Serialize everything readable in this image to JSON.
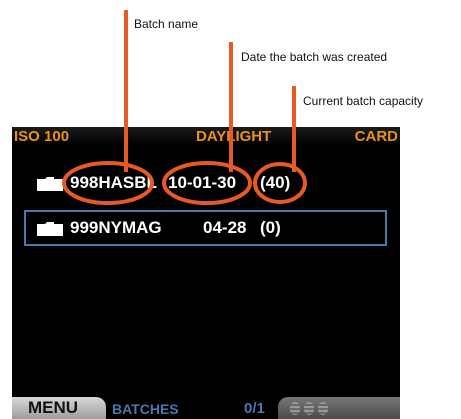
{
  "callouts": {
    "batch_name": "Batch name",
    "date_created": "Date the batch was created",
    "capacity": "Current batch capacity"
  },
  "status_bar": {
    "iso": "ISO 100",
    "white_balance": "DAYLIGHT",
    "storage": "CARD"
  },
  "batches": [
    {
      "name": "998HASBL",
      "date": "10-01-30",
      "count": "(40)",
      "icon": "folder-icon"
    },
    {
      "name": "999NYMAG",
      "date": "04-28",
      "count": "(0)",
      "icon": "folder-icon"
    }
  ],
  "bottom_bar": {
    "menu_label": "MENU",
    "section_label": "BATCHES",
    "page_indicator": "0/1"
  },
  "colors": {
    "callout_line": "#e85a24",
    "status_text": "#e8911f",
    "accent_blue": "#4a78a8",
    "screen_bg": "#000000"
  }
}
